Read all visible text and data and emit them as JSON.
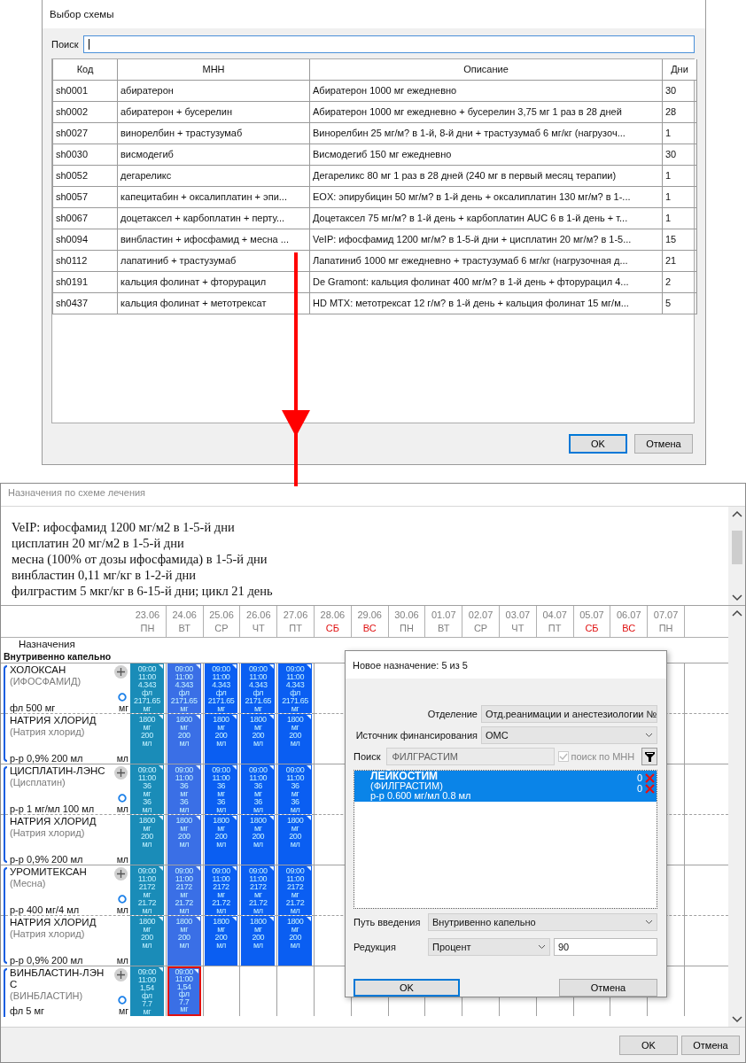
{
  "scheme_dialog": {
    "title": "Выбор схемы",
    "search": {
      "label": "Поиск"
    },
    "columns": [
      "Код",
      "МНН",
      "Описание",
      "Дни"
    ],
    "rows": [
      [
        "sh0001",
        "абиратерон",
        "Абиратерон 1000 мг ежедневно",
        "30"
      ],
      [
        "sh0002",
        "абиратерон + бусерелин",
        "Абиратерон 1000 мг ежедневно + бусерелин 3,75 мг 1 раз в 28 дней",
        "28"
      ],
      [
        "sh0027",
        "винорелбин + трастузумаб",
        "Винорелбин 25 мг/м? в 1-й, 8-й дни + трастузумаб 6 мг/кг (нагрузоч...",
        "1"
      ],
      [
        "sh0030",
        "висмодегиб",
        "Висмодегиб 150 мг ежедневно",
        "30"
      ],
      [
        "sh0052",
        "дегареликс",
        "Дегареликс 80 мг 1 раз в 28 дней (240 мг в первый месяц терапии)",
        "1"
      ],
      [
        "sh0057",
        "капецитабин + оксалиплатин + эпи...",
        "EOX: эпирубицин 50 мг/м? в 1-й день + оксалиплатин 130 мг/м? в 1-...",
        "1"
      ],
      [
        "sh0067",
        "доцетаксел + карбоплатин + перту...",
        "Доцетаксел 75 мг/м? в 1-й день + карбоплатин AUC 6 в 1-й день + т...",
        "1"
      ],
      [
        "sh0094",
        "винбластин + ифосфамид + месна ...",
        "VeIP: ифосфамид 1200 мг/м? в 1-5-й дни + цисплатин 20 мг/м? в 1-5...",
        "15"
      ],
      [
        "sh0112",
        "лапатиниб + трастузумаб",
        "Лапатиниб 1000 мг ежедневно + трастузумаб 6 мг/кг (нагрузочная д...",
        "21"
      ],
      [
        "sh0191",
        "кальция фолинат + фторурацил",
        "De Gramont: кальция фолинат 400 мг/м? в 1-й день + фторурацил 4...",
        "2"
      ],
      [
        "sh0437",
        "кальция фолинат + метотрексат",
        "HD MTX: метотрексат 12 г/м? в 1-й день + кальция фолинат 15 мг/м...",
        "5"
      ]
    ],
    "buttons": [
      "OK",
      "Отмена"
    ]
  },
  "schedule_window": {
    "title": "Назначения по схеме лечения",
    "description_lines": [
      "VeIP: ифосфамид 1200 мг/м2 в 1-5-й дни",
      "цисплатин 20 мг/м2 в 1-5-й дни",
      "месна (100% от дозы ифосфамида) в 1-5-й дни",
      "винбластин 0,11 мг/кг в 1-2-й дни",
      "филграстим 5 мкг/кг в 6-15-й дни; цикл 21 день"
    ],
    "days": [
      {
        "date": "23.06",
        "weekday": "ПН",
        "weekend": false
      },
      {
        "date": "24.06",
        "weekday": "ВТ",
        "weekend": false
      },
      {
        "date": "25.06",
        "weekday": "СР",
        "weekend": false
      },
      {
        "date": "26.06",
        "weekday": "ЧТ",
        "weekend": false
      },
      {
        "date": "27.06",
        "weekday": "ПТ",
        "weekend": false
      },
      {
        "date": "28.06",
        "weekday": "СБ",
        "weekend": true
      },
      {
        "date": "29.06",
        "weekday": "ВС",
        "weekend": true
      },
      {
        "date": "30.06",
        "weekday": "ПН",
        "weekend": false
      },
      {
        "date": "01.07",
        "weekday": "ВТ",
        "weekend": false
      },
      {
        "date": "02.07",
        "weekday": "СР",
        "weekend": false
      },
      {
        "date": "03.07",
        "weekday": "ЧТ",
        "weekend": false
      },
      {
        "date": "04.07",
        "weekday": "ПТ",
        "weekend": false
      },
      {
        "date": "05.07",
        "weekday": "СБ",
        "weekend": true
      },
      {
        "date": "06.07",
        "weekday": "ВС",
        "weekend": true
      },
      {
        "date": "07.07",
        "weekday": "ПН",
        "weekend": false
      }
    ],
    "section_label": "Назначения",
    "route_label": "Внутривенно капельно",
    "groups": [
      {
        "drugs": [
          {
            "kind": "drug",
            "name": "ХОЛОКСАН",
            "inn": "(ИФОСФАМИД)",
            "form": "фл 500 мг",
            "unit": "мг",
            "doses": [
              {
                "lines": [
                  "09:00",
                  "11:00",
                  "4.343",
                  "фл",
                  "2171.65",
                  "мг"
                ],
                "color": "#1a8cb8",
                "selected": false
              },
              {
                "lines": [
                  "09:00",
                  "11:00",
                  "4.343",
                  "фл",
                  "2171.65",
                  "мг"
                ],
                "color": "#3a6fe6",
                "selected": false
              },
              {
                "lines": [
                  "09:00",
                  "11:00",
                  "4.343",
                  "фл",
                  "2171.65",
                  "мг"
                ],
                "color": "#0a5ef2",
                "selected": false
              },
              {
                "lines": [
                  "09:00",
                  "11:00",
                  "4.343",
                  "фл",
                  "2171.65",
                  "мг"
                ],
                "color": "#0a5ef2",
                "selected": false
              },
              {
                "lines": [
                  "09:00",
                  "11:00",
                  "4.343",
                  "фл",
                  "2171.65",
                  "мг"
                ],
                "color": "#0a5ef2",
                "selected": false
              }
            ]
          },
          {
            "kind": "diluent",
            "name": "НАТРИЯ ХЛОРИД",
            "inn": "(Натрия хлорид)",
            "form": "р-р 0,9% 200 мл",
            "unit": "мл",
            "doses": [
              {
                "lines": [
                  "1800",
                  "мг",
                  "200",
                  "мл"
                ],
                "color": "#1a8cb8",
                "selected": false
              },
              {
                "lines": [
                  "1800",
                  "мг",
                  "200",
                  "мл"
                ],
                "color": "#3a6fe6",
                "selected": false
              },
              {
                "lines": [
                  "1800",
                  "мг",
                  "200",
                  "мл"
                ],
                "color": "#0a5ef2",
                "selected": false
              },
              {
                "lines": [
                  "1800",
                  "мг",
                  "200",
                  "мл"
                ],
                "color": "#0a5ef2",
                "selected": false
              },
              {
                "lines": [
                  "1800",
                  "мг",
                  "200",
                  "мл"
                ],
                "color": "#0a5ef2",
                "selected": false
              }
            ]
          }
        ]
      },
      {
        "drugs": [
          {
            "kind": "drug",
            "name": "ЦИСПЛАТИН-ЛЭНС",
            "inn": "(Цисплатин)",
            "form": "р-р 1 мг/мл 100 мл",
            "unit": "мл",
            "doses": [
              {
                "lines": [
                  "09:00",
                  "11:00",
                  "36",
                  "мг",
                  "36",
                  "мл"
                ],
                "color": "#1a8cb8",
                "selected": false
              },
              {
                "lines": [
                  "09:00",
                  "11:00",
                  "36",
                  "мг",
                  "36",
                  "мл"
                ],
                "color": "#3a6fe6",
                "selected": false
              },
              {
                "lines": [
                  "09:00",
                  "11:00",
                  "36",
                  "мг",
                  "36",
                  "мл"
                ],
                "color": "#0a5ef2",
                "selected": false
              },
              {
                "lines": [
                  "09:00",
                  "11:00",
                  "36",
                  "мг",
                  "36",
                  "мл"
                ],
                "color": "#0a5ef2",
                "selected": false
              },
              {
                "lines": [
                  "09:00",
                  "11:00",
                  "36",
                  "мг",
                  "36",
                  "мл"
                ],
                "color": "#0a5ef2",
                "selected": false
              }
            ]
          },
          {
            "kind": "diluent",
            "name": "НАТРИЯ ХЛОРИД",
            "inn": "(Натрия хлорид)",
            "form": "р-р 0,9% 200 мл",
            "unit": "мл",
            "doses": [
              {
                "lines": [
                  "1800",
                  "мг",
                  "200",
                  "мл"
                ],
                "color": "#1a8cb8",
                "selected": false
              },
              {
                "lines": [
                  "1800",
                  "мг",
                  "200",
                  "мл"
                ],
                "color": "#3a6fe6",
                "selected": false
              },
              {
                "lines": [
                  "1800",
                  "мг",
                  "200",
                  "мл"
                ],
                "color": "#0a5ef2",
                "selected": false
              },
              {
                "lines": [
                  "1800",
                  "мг",
                  "200",
                  "мл"
                ],
                "color": "#0a5ef2",
                "selected": false
              },
              {
                "lines": [
                  "1800",
                  "мг",
                  "200",
                  "мл"
                ],
                "color": "#0a5ef2",
                "selected": false
              }
            ]
          }
        ]
      },
      {
        "drugs": [
          {
            "kind": "drug",
            "name": "УРОМИТЕКСАН",
            "inn": "(Месна)",
            "form": "р-р 400 мг/4 мл",
            "unit": "мл",
            "doses": [
              {
                "lines": [
                  "09:00",
                  "11:00",
                  "2172",
                  "мг",
                  "21.72",
                  "мл"
                ],
                "color": "#1a8cb8",
                "selected": false
              },
              {
                "lines": [
                  "09:00",
                  "11:00",
                  "2172",
                  "мг",
                  "21.72",
                  "мл"
                ],
                "color": "#3a6fe6",
                "selected": false
              },
              {
                "lines": [
                  "09:00",
                  "11:00",
                  "2172",
                  "мг",
                  "21.72",
                  "мл"
                ],
                "color": "#0a5ef2",
                "selected": false
              },
              {
                "lines": [
                  "09:00",
                  "11:00",
                  "2172",
                  "мг",
                  "21.72",
                  "мл"
                ],
                "color": "#0a5ef2",
                "selected": false
              },
              {
                "lines": [
                  "09:00",
                  "11:00",
                  "2172",
                  "мг",
                  "21.72",
                  "мл"
                ],
                "color": "#0a5ef2",
                "selected": false
              }
            ]
          },
          {
            "kind": "diluent",
            "name": "НАТРИЯ ХЛОРИД",
            "inn": "(Натрия хлорид)",
            "form": "р-р 0,9% 200 мл",
            "unit": "мл",
            "doses": [
              {
                "lines": [
                  "1800",
                  "мг",
                  "200",
                  "мл"
                ],
                "color": "#1a8cb8",
                "selected": false
              },
              {
                "lines": [
                  "1800",
                  "мг",
                  "200",
                  "мл"
                ],
                "color": "#3a6fe6",
                "selected": false
              },
              {
                "lines": [
                  "1800",
                  "мг",
                  "200",
                  "мл"
                ],
                "color": "#0a5ef2",
                "selected": false
              },
              {
                "lines": [
                  "1800",
                  "мг",
                  "200",
                  "мл"
                ],
                "color": "#0a5ef2",
                "selected": false
              },
              {
                "lines": [
                  "1800",
                  "мг",
                  "200",
                  "мл"
                ],
                "color": "#0a5ef2",
                "selected": false
              }
            ]
          }
        ]
      },
      {
        "drugs": [
          {
            "kind": "drug",
            "name": "ВИНБЛАСТИН-ЛЭНС",
            "inn": "(ВИНБЛАСТИН)",
            "form": "фл 5 мг",
            "unit": "мг",
            "doses": [
              {
                "lines": [
                  "09:00",
                  "11:00",
                  "1,54",
                  "фл",
                  "7.7",
                  "мг"
                ],
                "color": "#1a8cb8",
                "selected": false
              },
              {
                "lines": [
                  "09:00",
                  "11:00",
                  "1,54",
                  "фл",
                  "7.7",
                  "мг"
                ],
                "color": "#3a6fe6",
                "selected": true
              }
            ]
          }
        ]
      }
    ],
    "new_order_dialog": {
      "title": "Новое назначение: 5 из 5",
      "department": {
        "label": "Отделение",
        "value": "Отд.реанимации и анестезиологии №"
      },
      "funding": {
        "label": "Источник финансирования",
        "value": "ОМС"
      },
      "search": {
        "label": "Поиск",
        "value": "ФИЛГРАСТИМ",
        "disabled": true
      },
      "mnn_search": {
        "label": "поиск по МНН",
        "checked": true,
        "disabled": true
      },
      "results": [
        {
          "name": "ЛЕЙКОСТИМ",
          "inn": "(ФИЛГРАСТИМ)",
          "form": "р-р 0.600 мг/мл 0.8 мл",
          "counts": [
            "0",
            "0"
          ],
          "selected": true
        }
      ],
      "route": {
        "label": "Путь введения",
        "value": "Внутривенно капельно"
      },
      "reduction": {
        "label": "Редукция",
        "type": "Процент",
        "value": "90"
      },
      "buttons": [
        {
          "label": "OK",
          "default": true
        },
        {
          "label": "Отмена",
          "default": false
        }
      ]
    },
    "buttons": [
      "OK",
      "Отмена"
    ]
  }
}
